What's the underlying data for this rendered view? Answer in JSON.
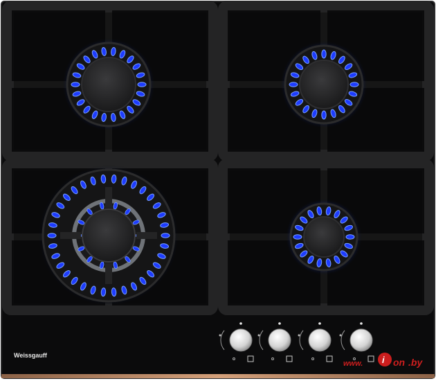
{
  "hob": {
    "brand": "Weissgauff",
    "colors": {
      "glass": "#0b0b0c",
      "frame": "#1c1c1d",
      "grate": "#242425",
      "flame_core": "#1e3cff",
      "flame_glow": "#7aa2ff",
      "knob": "#d9d9d9",
      "trim": "#b98a68"
    },
    "burners": [
      {
        "name": "rear-left",
        "type": "standard"
      },
      {
        "name": "rear-right",
        "type": "standard"
      },
      {
        "name": "front-left",
        "type": "triple-crown"
      },
      {
        "name": "front-right",
        "type": "small"
      }
    ],
    "knobs": [
      {
        "name": "knob-1"
      },
      {
        "name": "knob-2"
      },
      {
        "name": "knob-3"
      },
      {
        "name": "knob-4"
      }
    ]
  },
  "watermark": {
    "prefix": "www.",
    "name": "i",
    "mid": "on",
    "suffix": ".by"
  }
}
